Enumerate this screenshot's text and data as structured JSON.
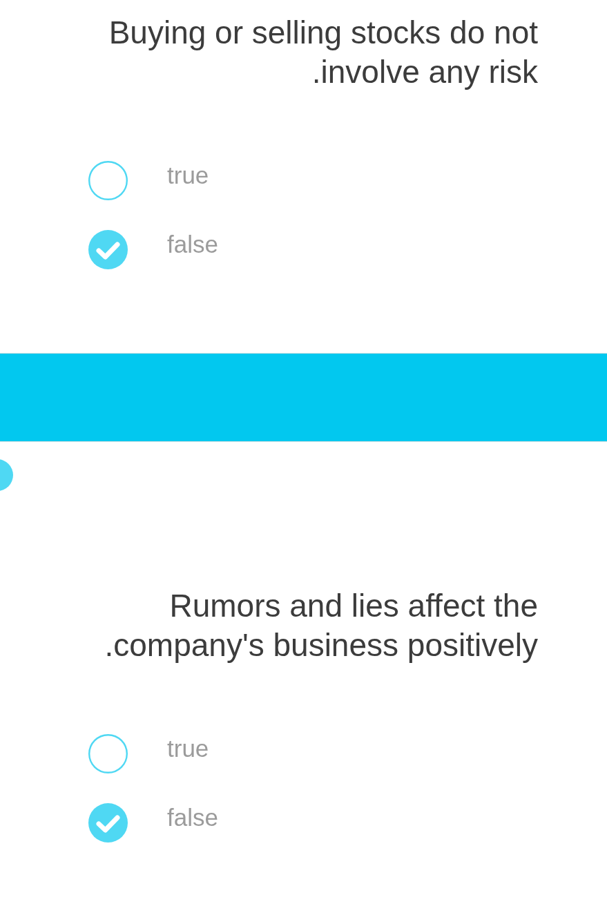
{
  "questions": [
    {
      "text": "Buying or selling stocks do not .involve any risk",
      "options": [
        {
          "label": "true",
          "selected": false
        },
        {
          "label": "false",
          "selected": true
        }
      ]
    },
    {
      "text": "Rumors and lies affect the .company's business positively",
      "options": [
        {
          "label": "true",
          "selected": false
        },
        {
          "label": "false",
          "selected": true
        }
      ]
    }
  ]
}
